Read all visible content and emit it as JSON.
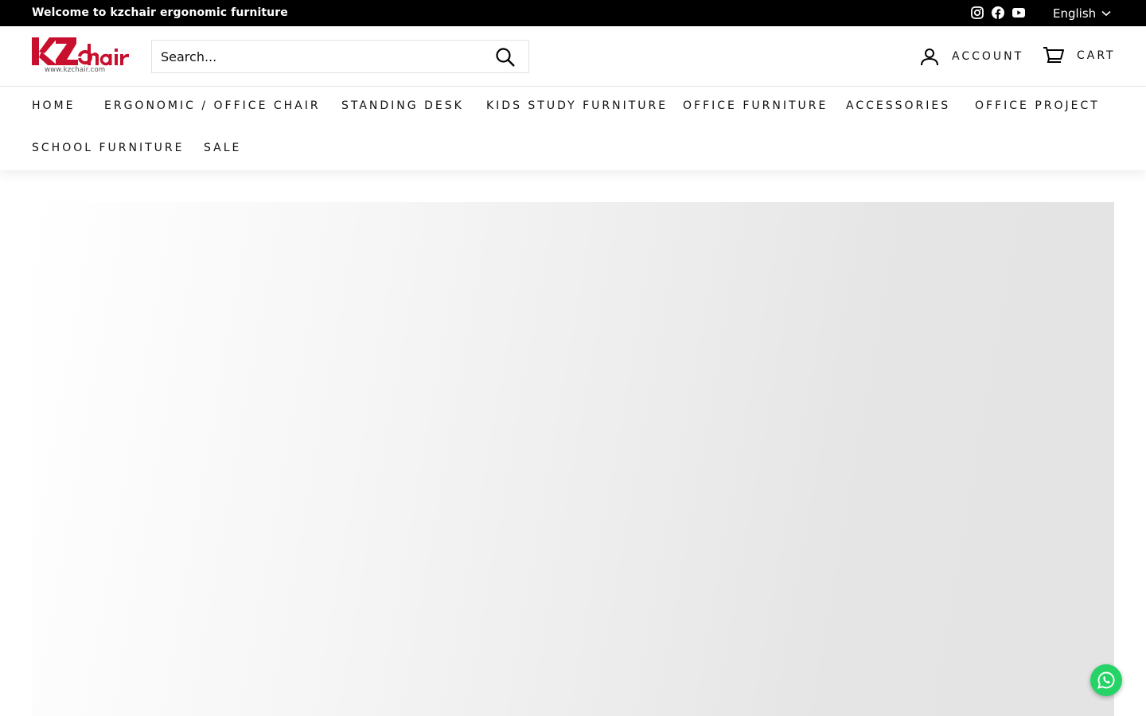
{
  "announcement": {
    "message": "Welcome to kzchair ergonomic furniture",
    "social": [
      "instagram-icon",
      "facebook-icon",
      "youtube-icon"
    ],
    "language": "English"
  },
  "header": {
    "logo_text": "www.kzchair.com",
    "search_placeholder": "Search...",
    "account_label": "ACCOUNT",
    "cart_label": "CART"
  },
  "nav": {
    "items": [
      "HOME",
      "ERGONOMIC / OFFICE CHAIR",
      "STANDING DESK",
      "KIDS STUDY FURNITURE",
      "OFFICE FURNITURE",
      "ACCESSORIES",
      "OFFICE PROJECT",
      "SCHOOL FURNITURE",
      "SALE"
    ]
  },
  "colors": {
    "brand_red": "#c8102e",
    "whatsapp_green": "#25d366",
    "bar_black": "#000000"
  }
}
